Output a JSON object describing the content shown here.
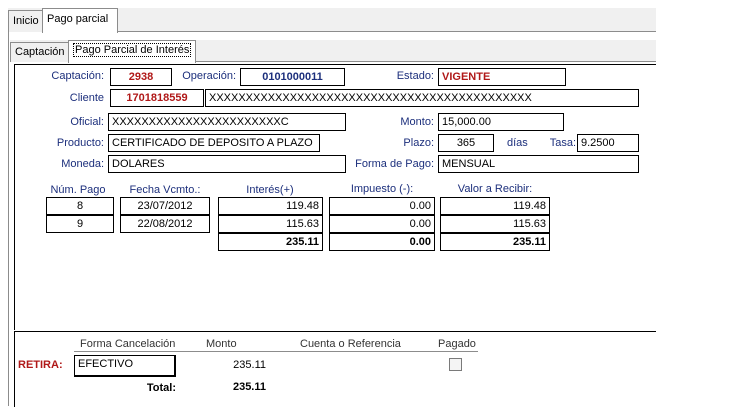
{
  "tabs": [
    "Inicio",
    "Pago parcial"
  ],
  "subtabs": [
    "Captación",
    "Pago Parcial de Interés"
  ],
  "form": {
    "captacion_label": "Captación:",
    "captacion_value": "2938",
    "operacion_label": "Operación:",
    "operacion_value": "0101000011",
    "estado_label": "Estado:",
    "estado_value": "VIGENTE",
    "cliente_label": "Cliente",
    "cliente_id": "1701818559",
    "cliente_name": "XXXXXXXXXXXXXXXXXXXXXXXXXXXXXXXXXXXXXXXXXXXX",
    "oficial_label": "Oficial:",
    "oficial_value": "XXXXXXXXXXXXXXXXXXXXXXXC",
    "monto_label": "Monto:",
    "monto_value": "15,000.00",
    "producto_label": "Producto:",
    "producto_value": "CERTIFICADO DE DEPOSITO A PLAZO",
    "plazo_label": "Plazo:",
    "plazo_value": "365",
    "plazo_unit": "días",
    "tasa_label": "Tasa:",
    "tasa_value": "9.2500",
    "moneda_label": "Moneda:",
    "moneda_value": "DOLARES",
    "forma_pago_label": "Forma de Pago:",
    "forma_pago_value": "MENSUAL"
  },
  "table": {
    "headers": [
      "Núm. Pago",
      "Fecha Vcmto.:",
      "Interés(+)",
      "Impuesto (-):",
      "Valor a Recibir:"
    ],
    "rows": [
      [
        "8",
        "23/07/2012",
        "119.48",
        "0.00",
        "119.48"
      ],
      [
        "9",
        "22/08/2012",
        "115.63",
        "0.00",
        "115.63"
      ]
    ],
    "totals": [
      "235.11",
      "0.00",
      "235.11"
    ]
  },
  "cancel": {
    "headers": [
      "Forma Cancelación",
      "Monto",
      "Cuenta o Referencia",
      "Pagado"
    ],
    "retira_label": "RETIRA:",
    "forma_value": "EFECTIVO",
    "monto_value": "235.11",
    "total_label": "Total:",
    "total_value": "235.11",
    "pagado_checked": false
  }
}
